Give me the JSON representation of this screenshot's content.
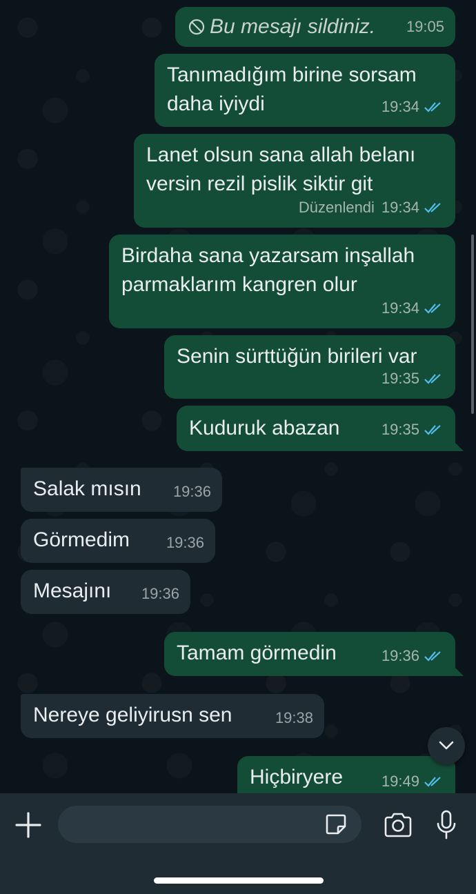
{
  "messages": [
    {
      "id": "m1",
      "dir": "out",
      "deleted": true,
      "text": "Bu mesajı sildiniz.",
      "time": "19:05"
    },
    {
      "id": "m2",
      "dir": "out",
      "lines": [
        "Tanımadığım birine sorsam",
        "daha iyiydi"
      ],
      "time": "19:34",
      "read": true
    },
    {
      "id": "m3",
      "dir": "out",
      "lines": [
        "Lanet olsun sana allah belanı",
        "versin rezil pislik siktir git"
      ],
      "edited_label": "Düzenlendi",
      "time": "19:34",
      "read": true
    },
    {
      "id": "m4",
      "dir": "out",
      "lines": [
        "Birdaha sana yazarsam inşallah",
        "parmaklarım kangren olur"
      ],
      "time": "19:34",
      "read": true
    },
    {
      "id": "m5",
      "dir": "out",
      "lines": [
        "Senin sürttüğün birileri var"
      ],
      "time": "19:35",
      "read": true
    },
    {
      "id": "m6",
      "dir": "out",
      "text": "Kuduruk abazan",
      "time": "19:35",
      "read": true
    },
    {
      "id": "m7",
      "dir": "in",
      "text": "Salak mısın",
      "time": "19:36"
    },
    {
      "id": "m8",
      "dir": "in",
      "text": "Görmedim",
      "time": "19:36"
    },
    {
      "id": "m9",
      "dir": "in",
      "text": "Mesajını",
      "time": "19:36"
    },
    {
      "id": "m10",
      "dir": "out",
      "text": "Tamam görmedin",
      "time": "19:36",
      "read": true
    },
    {
      "id": "m11",
      "dir": "in",
      "text": "Nereye geliyirusn sen",
      "time": "19:38"
    },
    {
      "id": "m12",
      "dir": "out",
      "text": "Hiçbiryere",
      "time": "19:49",
      "read": true
    }
  ],
  "composer": {
    "plus_icon": "plus-icon",
    "sticker_icon": "sticker-icon",
    "camera_icon": "camera-icon",
    "mic_icon": "microphone-icon"
  },
  "colors": {
    "background": "#0b141a",
    "outgoing_bubble": "#144d37",
    "incoming_bubble": "#202c33",
    "read_ticks": "#53bdeb",
    "composer_bar": "#1f2c33"
  }
}
